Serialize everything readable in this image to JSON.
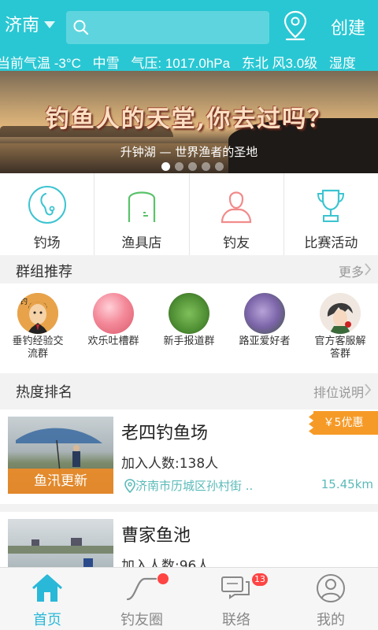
{
  "header": {
    "city": "济南",
    "search_placeholder": "",
    "create_label": "创建",
    "bg_color": "#29c7d3"
  },
  "weather": {
    "items": [
      "当前气温 -3°C",
      "中雪",
      "气压: 1017.0hPa",
      "东北 风3.0级",
      "湿度"
    ]
  },
  "banner": {
    "title": "钓鱼人的天堂,你去过吗？",
    "subtitle": "升钟湖 — 世界渔者的圣地",
    "page_count": 5,
    "active_page": 1
  },
  "categories": [
    {
      "label": "钓场",
      "icon": "location-pin-icon"
    },
    {
      "label": "渔具店",
      "icon": "shop-door-icon"
    },
    {
      "label": "钓友",
      "icon": "person-icon"
    },
    {
      "label": "比赛活动",
      "icon": "trophy-icon"
    }
  ],
  "group_section": {
    "title": "群组推荐",
    "more": "更多"
  },
  "groups": [
    {
      "label": "垂钓经验交流群"
    },
    {
      "label": "欢乐吐槽群"
    },
    {
      "label": "新手报道群"
    },
    {
      "label": "路亚爱好者"
    },
    {
      "label": "官方客服解答群"
    }
  ],
  "rank_section": {
    "title": "热度排名",
    "more": "排位说明"
  },
  "rankings": [
    {
      "name": "老四钓鱼场",
      "joined": "加入人数:138人",
      "address": "济南市历城区孙村街 ..",
      "distance": "15.45km",
      "coupon": "￥5优惠",
      "thumb_caption": "鱼汛更新"
    },
    {
      "name": "曹家鱼池",
      "joined": "加入人数:96人"
    }
  ],
  "tabs": [
    {
      "label": "首页",
      "active": true
    },
    {
      "label": "钓友圈"
    },
    {
      "label": "联络",
      "badge": "13"
    },
    {
      "label": "我的"
    }
  ],
  "colors": {
    "accent": "#29c7d3",
    "tab_active": "#2ab8d8",
    "coupon": "#f69a27",
    "badge": "#ff4444"
  }
}
